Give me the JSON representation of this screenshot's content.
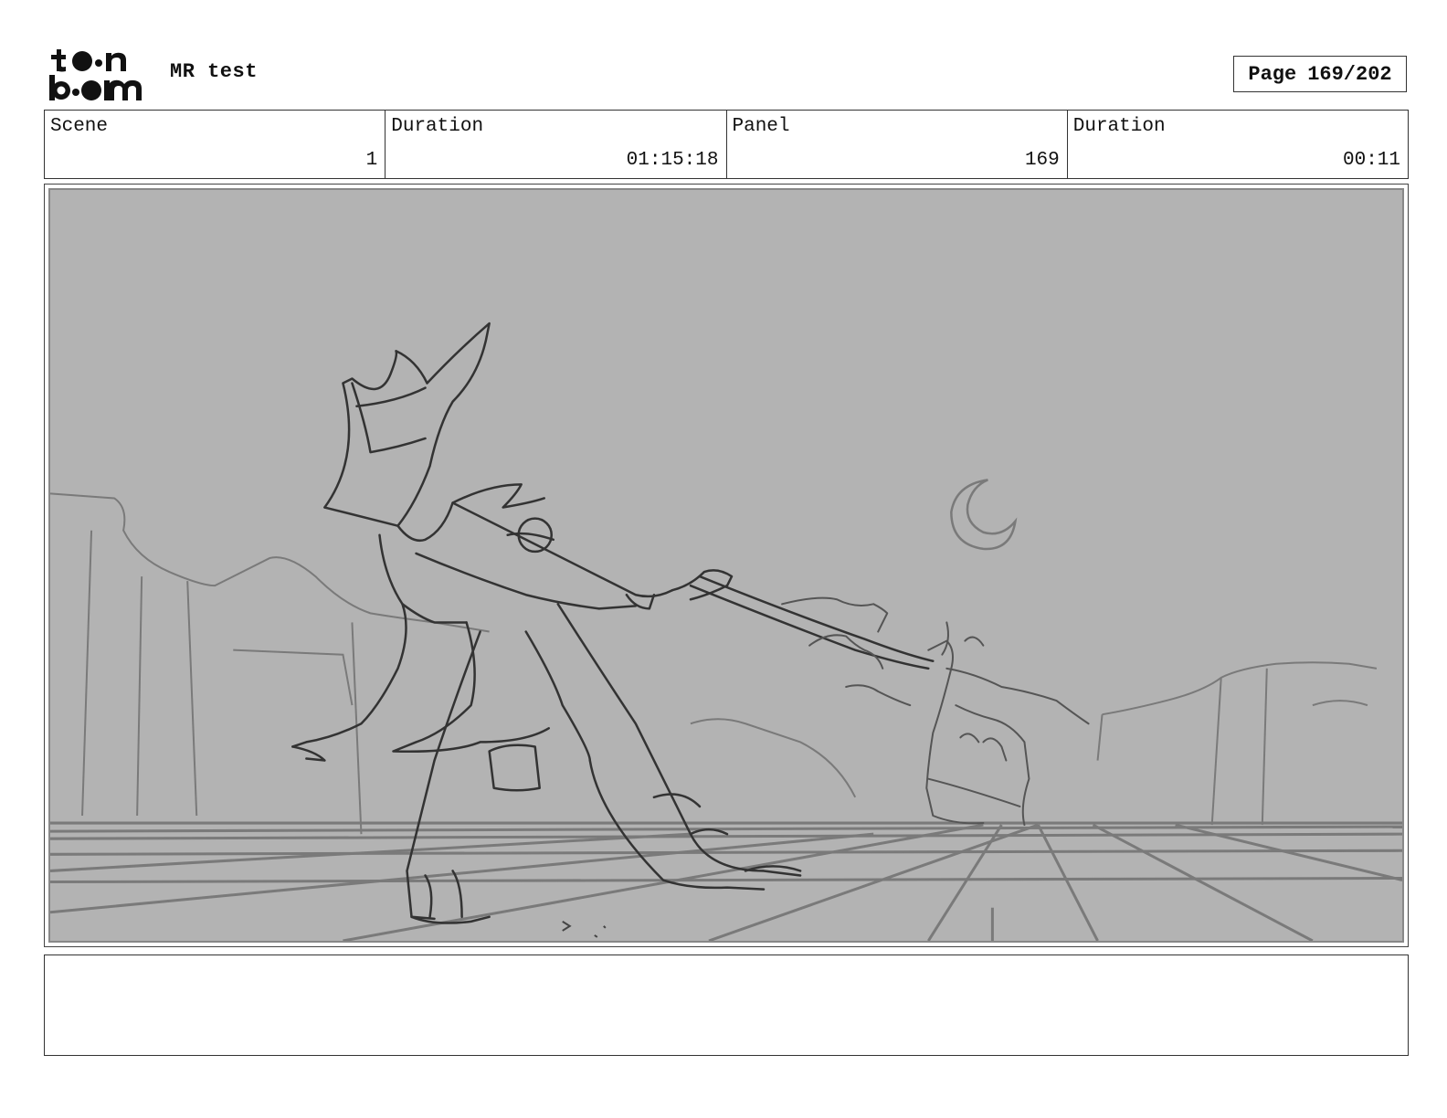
{
  "header": {
    "logo_text": "toon boom",
    "project_title": "MR test",
    "page_label": "Page",
    "page_number": "169/202"
  },
  "info": {
    "scene_label": "Scene",
    "scene_value": "1",
    "scene_duration_label": "Duration",
    "scene_duration_value": "01:15:18",
    "panel_label": "Panel",
    "panel_value": "169",
    "panel_duration_label": "Duration",
    "panel_duration_value": "00:11"
  },
  "notes": {
    "text": ""
  }
}
